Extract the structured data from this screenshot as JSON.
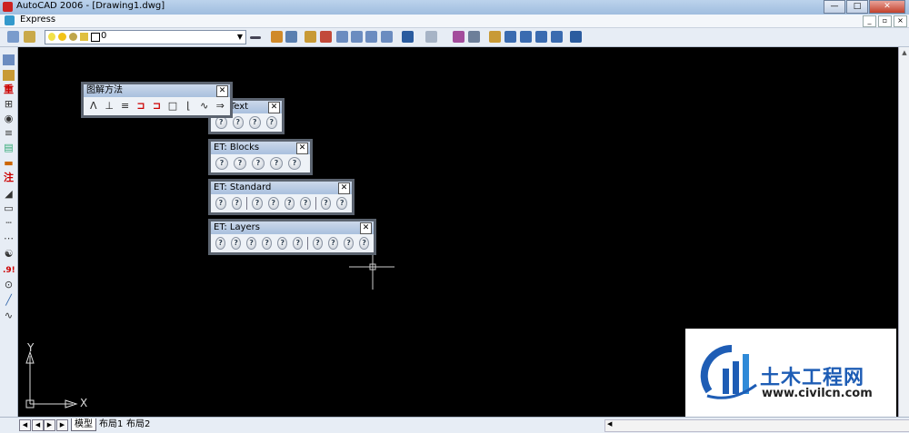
{
  "window": {
    "title": "AutoCAD 2006 - [Drawing1.dwg]",
    "min_icon": "minimize-icon",
    "max_icon": "maximize-icon",
    "close_icon": "close-icon"
  },
  "menubar": {
    "items": [
      "Express"
    ],
    "mdi": [
      "_",
      "▫",
      "×"
    ]
  },
  "toolbar": {
    "layer_value": "0"
  },
  "palettes": {
    "tujie": {
      "title": "图解方法"
    },
    "text": {
      "title": "ET: Text"
    },
    "blocks": {
      "title": "ET: Blocks"
    },
    "standard": {
      "title": "ET: Standard"
    },
    "layers": {
      "title": "ET: Layers"
    },
    "close": "✕",
    "help": "?"
  },
  "left_toolbar": {
    "labels": [
      "重",
      "注",
      ".9!"
    ]
  },
  "ucs": {
    "x_label": "X",
    "y_label": "Y"
  },
  "layout_tabs": [
    "模型",
    "布局1",
    "布局2"
  ],
  "watermark": {
    "brand": "土木工程网",
    "url": "www.civilcn.com"
  },
  "colors": {
    "canvas": "#000000",
    "watermark_blue": "#1e5db5",
    "brand_red": "#d12a1d"
  }
}
